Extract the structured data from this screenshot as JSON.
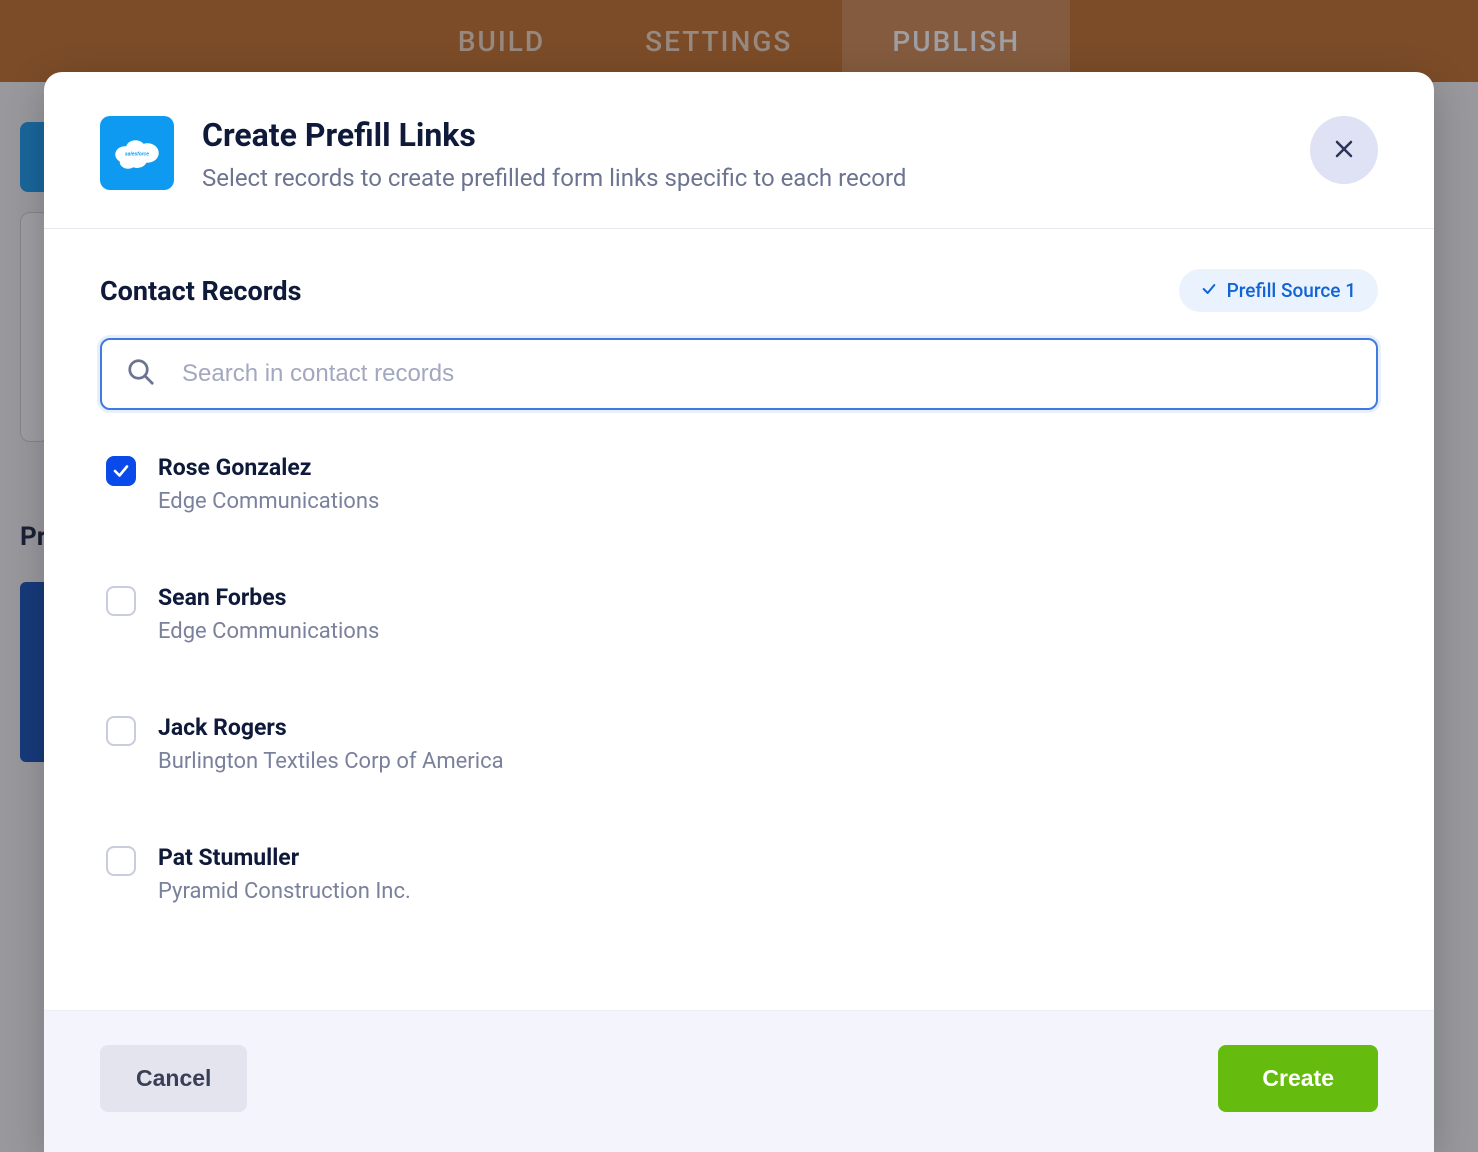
{
  "nav": {
    "tabs": [
      "BUILD",
      "SETTINGS",
      "PUBLISH"
    ],
    "active": 2
  },
  "bg": {
    "label_fragment": "Pr"
  },
  "modal": {
    "title": "Create Prefill Links",
    "subtitle": "Select records to create prefilled form links specific to each record",
    "section_title": "Contact Records",
    "pill_label": "Prefill Source 1",
    "search_placeholder": "Search in contact records",
    "records": [
      {
        "name": "Rose Gonzalez",
        "sub": "Edge Communications",
        "checked": true
      },
      {
        "name": "Sean Forbes",
        "sub": "Edge Communications",
        "checked": false
      },
      {
        "name": "Jack Rogers",
        "sub": "Burlington Textiles Corp of America",
        "checked": false
      },
      {
        "name": "Pat Stumuller",
        "sub": "Pyramid Construction Inc.",
        "checked": false
      }
    ],
    "cancel_label": "Cancel",
    "create_label": "Create"
  }
}
